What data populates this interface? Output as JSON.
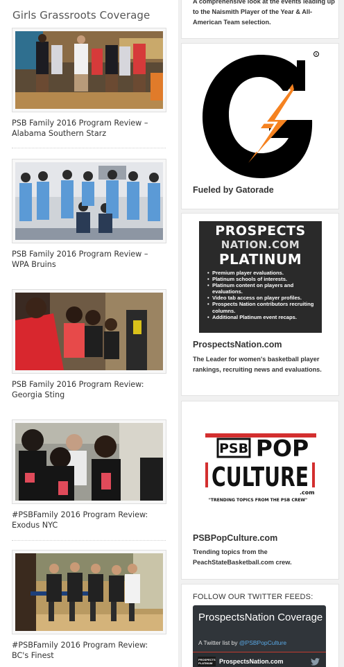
{
  "left": {
    "section_title": "Girls Grassroots Coverage",
    "articles": [
      {
        "title": "PSB Family 2016 Program Review – Alabama Southern Starz"
      },
      {
        "title": "PSB Family 2016 Program Review – WPA Bruins"
      },
      {
        "title": "PSB Family 2016 Program Review: Georgia Sting"
      },
      {
        "title": "#PSBFamily 2016 Program Review: Exodus NYC"
      },
      {
        "title": "#PSBFamily 2016 Program Review: BC's Finest"
      }
    ]
  },
  "sidebar": {
    "naismith": {
      "text": "A comprehensive look at the events leading up to the Naismith Player of the Year & All-American Team selection."
    },
    "gatorade": {
      "caption": "Fueled by Gatorade",
      "logo_icon": "gatorade-g-bolt-logo",
      "colors": {
        "g": "#000000",
        "bolt": "#f58220"
      }
    },
    "prospects": {
      "ad_line1": "PROSPECTS",
      "ad_line2": "NATION.COM",
      "ad_line3": "PLATINUM",
      "ad_bullets": [
        "Premium player evaluations.",
        "Platinum schools of interests.",
        "Platinum content on players and evaluations.",
        "Video tab access on player profiles.",
        "Prospects Nation contributors recruiting columns.",
        "Additional Platinum event recaps."
      ],
      "caption": "ProspectsNation.com",
      "text": "The Leader for women's basketball player rankings, recruiting news and evaluations."
    },
    "popculture": {
      "logo_psb": "PSB",
      "logo_pop": "POP",
      "logo_culture": "CULTURE",
      "logo_com": ".com",
      "logo_tagline": "\"TRENDING TOPICS FROM THE PSB CREW\"",
      "accent": "#d32f2f",
      "caption": "PSBPopCulture.com",
      "text": "Trending topics from the PeachStateBasketball.com crew."
    },
    "twitter": {
      "follow_title": "FOLLOW OUR TWITTER FEEDS:",
      "list_title": "ProspectsNation Coverage",
      "list_by": "A Twitter list by ",
      "list_owner": "@PSBPopCulture",
      "avatar_text": "PROSPECTS PLATINUM",
      "first_account": "ProspectsNation.com",
      "bird_icon": "twitter-bird-icon",
      "colors": {
        "bg": "#30353a",
        "link": "#59a9e6",
        "bar": "#c33b2f"
      }
    }
  }
}
